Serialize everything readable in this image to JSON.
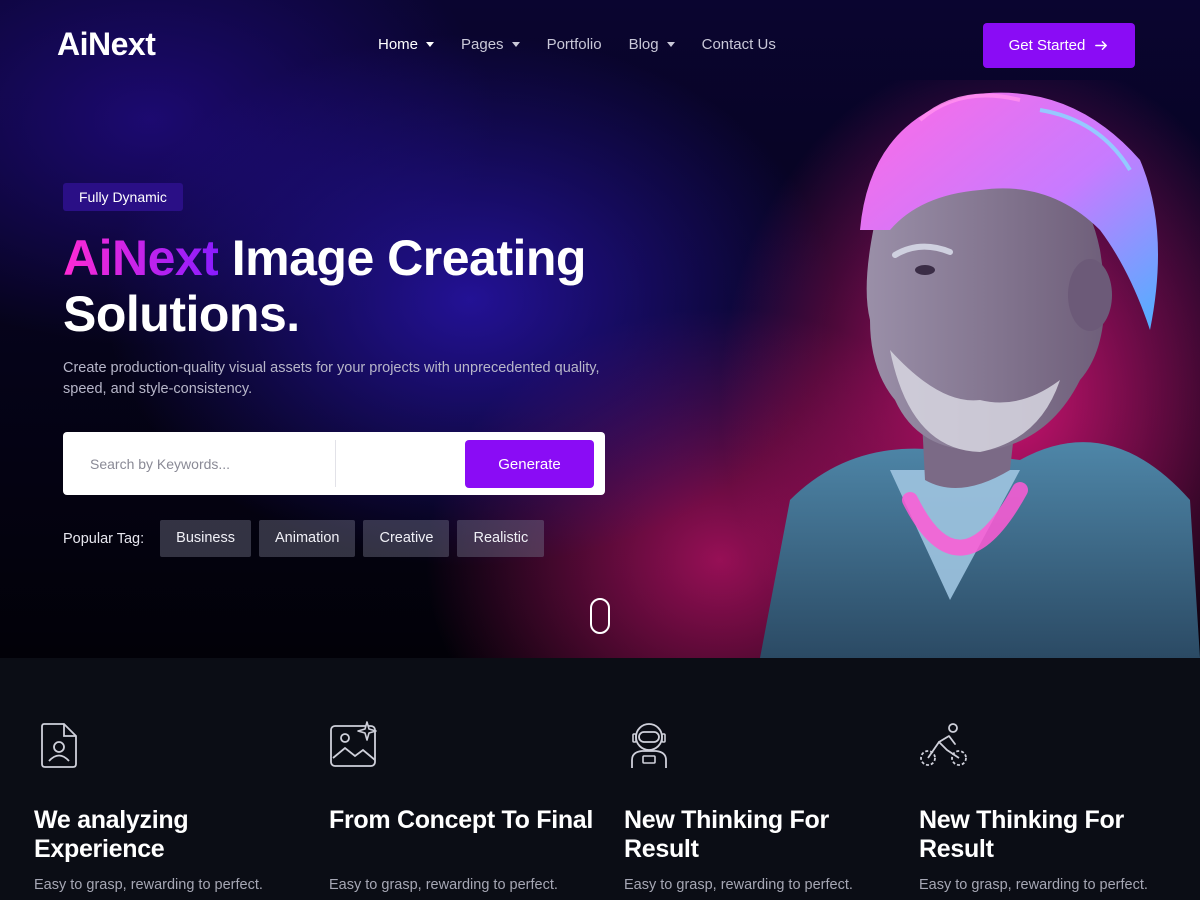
{
  "nav": {
    "logo": "AiNext",
    "items": [
      {
        "label": "Home",
        "dropdown": true,
        "active": true
      },
      {
        "label": "Pages",
        "dropdown": true,
        "active": false
      },
      {
        "label": "Portfolio",
        "dropdown": false,
        "active": false
      },
      {
        "label": "Blog",
        "dropdown": true,
        "active": false
      },
      {
        "label": "Contact Us",
        "dropdown": false,
        "active": false
      }
    ],
    "cta_label": "Get Started"
  },
  "hero": {
    "badge": "Fully Dynamic",
    "headline_brand": "AiNext",
    "headline_line1_rest": " Image Creating",
    "headline_line2": "Solutions.",
    "subtitle": "Create production-quality visual assets for your projects with unprecedented quality, speed, and style-consistency.",
    "search": {
      "placeholder": "Search by Keywords...",
      "value": "",
      "button_label": "Generate"
    },
    "tags_label": "Popular Tag:",
    "tags": [
      "Business",
      "Animation",
      "Creative",
      "Realistic"
    ]
  },
  "features": [
    {
      "icon": "document-user-icon",
      "title": "We analyzing Experience",
      "desc": "Easy to grasp, rewarding to perfect."
    },
    {
      "icon": "image-sparkle-icon",
      "title": "From Concept To Final",
      "desc": "Easy to grasp, rewarding to perfect."
    },
    {
      "icon": "astronaut-icon",
      "title": "New Thinking For Result",
      "desc": "Easy to grasp, rewarding to perfect."
    },
    {
      "icon": "cyclist-icon",
      "title": "New Thinking For Result",
      "desc": "Easy to grasp, rewarding to perfect."
    }
  ],
  "colors": {
    "accent": "#8a0cf5",
    "brand_gradient_start": "#ff2ad4",
    "brand_gradient_end": "#8a1cff",
    "features_bg": "#0b0d15"
  }
}
